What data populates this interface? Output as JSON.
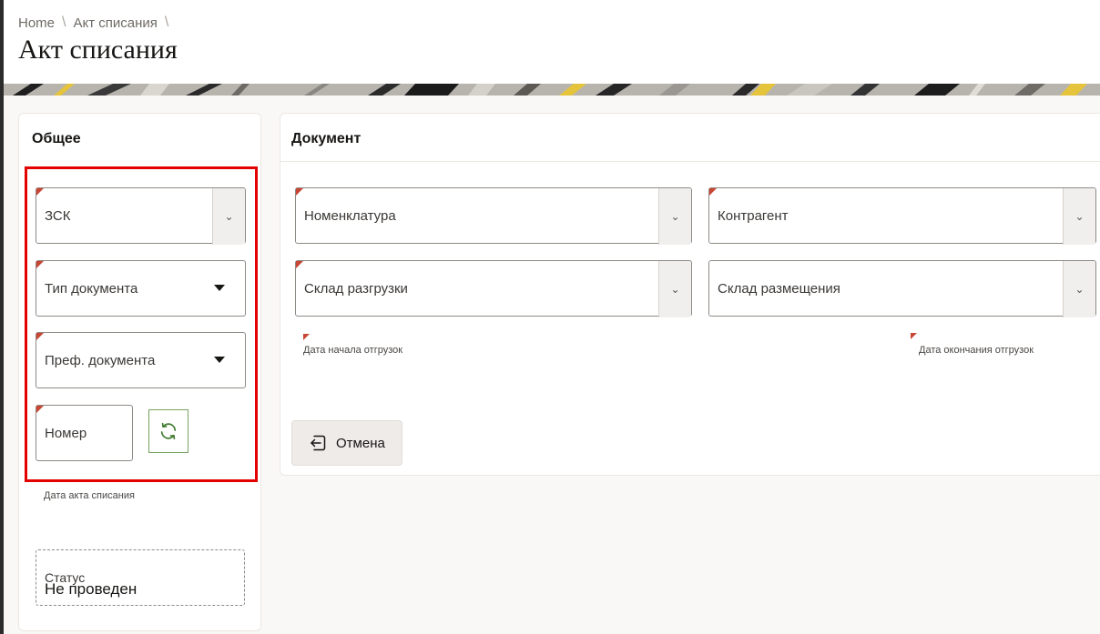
{
  "breadcrumb": {
    "home": "Home",
    "current": "Акт списания",
    "separator": "\\"
  },
  "page_title": "Акт списания",
  "general": {
    "title": "Общее",
    "fields": {
      "zsk": "ЗСК",
      "doc_type": "Тип документа",
      "doc_prefix": "Преф. документа",
      "number": "Номер",
      "writeoff_date": "Дата акта списания",
      "status_label": "Статус",
      "status_value": "Не проведен"
    }
  },
  "document": {
    "title": "Документ",
    "fields": {
      "nomenclature": "Номенклатура",
      "counterparty": "Контрагент",
      "unload_warehouse": "Склад разгрузки",
      "placement_warehouse": "Склад размещения",
      "ship_start": "Дата начала отгрузок",
      "ship_end": "Дата окончания отгрузок"
    },
    "cancel_label": "Отмена"
  },
  "colors": {
    "required": "#c74634",
    "highlight": "#e50000",
    "refresh_border": "#77a260"
  },
  "icons": {
    "chevron": "chevron-down-icon",
    "refresh": "refresh-icon",
    "cancel": "back-arrow-icon"
  }
}
